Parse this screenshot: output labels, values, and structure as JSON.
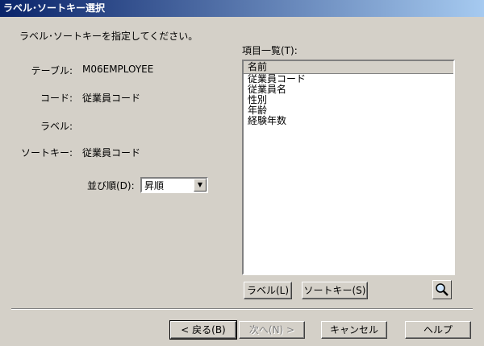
{
  "window": {
    "title": "ラベル･ソートキー選択"
  },
  "instruction": "ラベル･ソートキーを指定してください。",
  "fields": [
    {
      "label": "テーブル:",
      "value": "M06EMPLOYEE"
    },
    {
      "label": "コード:",
      "value": "従業員コード"
    },
    {
      "label": "ラベル:",
      "value": ""
    },
    {
      "label": "ソートキー:",
      "value": "従業員コード"
    }
  ],
  "order": {
    "label": "並び順(D):",
    "selected": "昇順"
  },
  "items_list": {
    "label": "項目一覧(T):",
    "header": "名前",
    "items": [
      "従業員コード",
      "従業員名",
      "性別",
      "年齢",
      "経験年数"
    ]
  },
  "list_buttons": {
    "label_btn": "ラベル(L)",
    "sortkey_btn": "ソートキー(S)"
  },
  "footer_buttons": {
    "back": "< 戻る(B)",
    "next": "次へ(N) >",
    "cancel": "キャンセル",
    "help": "ヘルプ"
  },
  "icons": {
    "search": "magnifier-icon",
    "dropdown": "chevron-down-icon"
  }
}
